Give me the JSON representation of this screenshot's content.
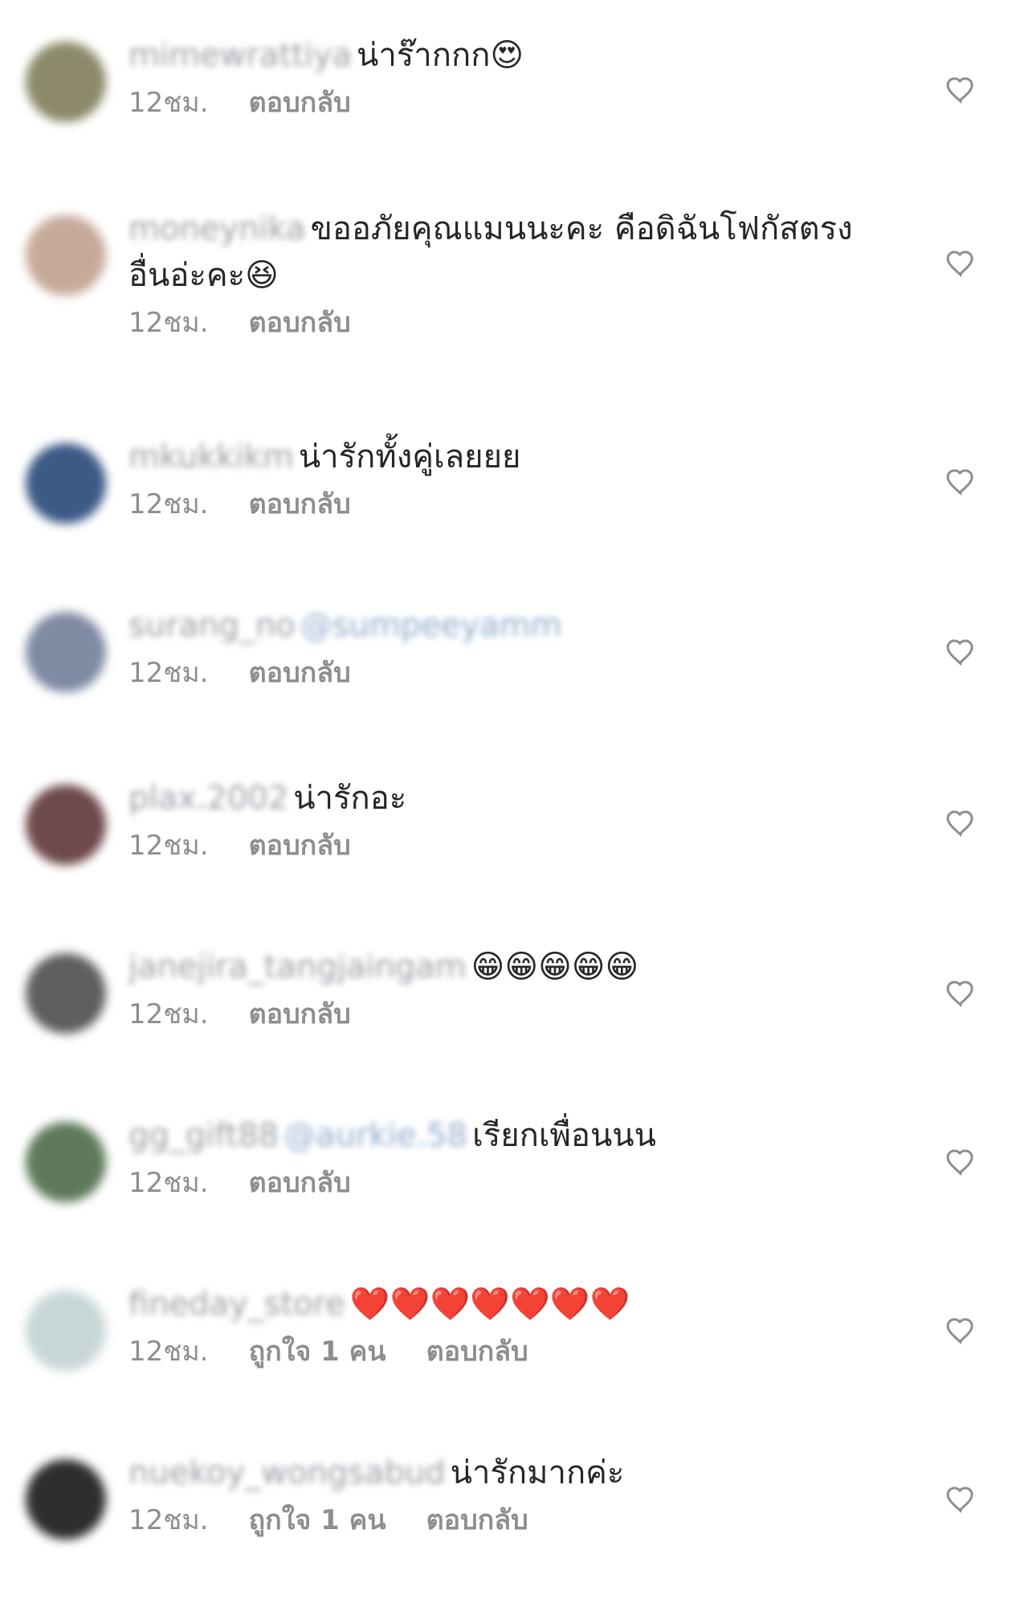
{
  "comments": [
    {
      "username": "mimewrattiya",
      "mention": "",
      "text": "น่าร๊ากกก",
      "emoji": "😍",
      "time": "12ชม.",
      "likes": "",
      "reply": "ตอบกลับ",
      "avatar_color": "#8c8a6a"
    },
    {
      "username": "moneynika",
      "mention": "",
      "text": "ขออภัยคุณแมนนะคะ คือดิฉันโฟกัสตรงอื่นอ่ะคะ",
      "emoji": "😆",
      "time": "12ชม.",
      "likes": "",
      "reply": "ตอบกลับ",
      "avatar_color": "#c7a99a"
    },
    {
      "username": "mkukkikm",
      "mention": "",
      "text": "น่ารักทั้งคู่เลยยย",
      "emoji": "",
      "time": "12ชม.",
      "likes": "",
      "reply": "ตอบกลับ",
      "avatar_color": "#3c5a86"
    },
    {
      "username": "surang_no",
      "mention": "@sumpeeyamm",
      "text": "",
      "emoji": "",
      "time": "12ชม.",
      "likes": "",
      "reply": "ตอบกลับ",
      "avatar_color": "#7f8aa3"
    },
    {
      "username": "plax.2002",
      "mention": "",
      "text": "น่ารักอะ",
      "emoji": "",
      "time": "12ชม.",
      "likes": "",
      "reply": "ตอบกลับ",
      "avatar_color": "#6e4a4a"
    },
    {
      "username": "janejira_tangjaingam",
      "mention": "",
      "text": "",
      "emoji": "😁😁😁😁😁",
      "time": "12ชม.",
      "likes": "",
      "reply": "ตอบกลับ",
      "avatar_color": "#5e5e5e"
    },
    {
      "username": "gg_gift88",
      "mention": "@aurkie.58",
      "text": "เรียกเพื่อนนน",
      "emoji": "",
      "time": "12ชม.",
      "likes": "",
      "reply": "ตอบกลับ",
      "avatar_color": "#5e7a5a"
    },
    {
      "username": "fineday_store",
      "mention": "",
      "text": "",
      "emoji": "❤️❤️❤️❤️❤️❤️❤️",
      "time": "12ชม.",
      "likes": "ถูกใจ 1 คน",
      "reply": "ตอบกลับ",
      "avatar_color": "#c9d6d8"
    },
    {
      "username": "nuekoy_wongsabud",
      "mention": "",
      "text": "น่ารักมากค่ะ",
      "emoji": "",
      "time": "12ชม.",
      "likes": "ถูกใจ 1 คน",
      "reply": "ตอบกลับ",
      "avatar_color": "#2e2e2e"
    }
  ]
}
